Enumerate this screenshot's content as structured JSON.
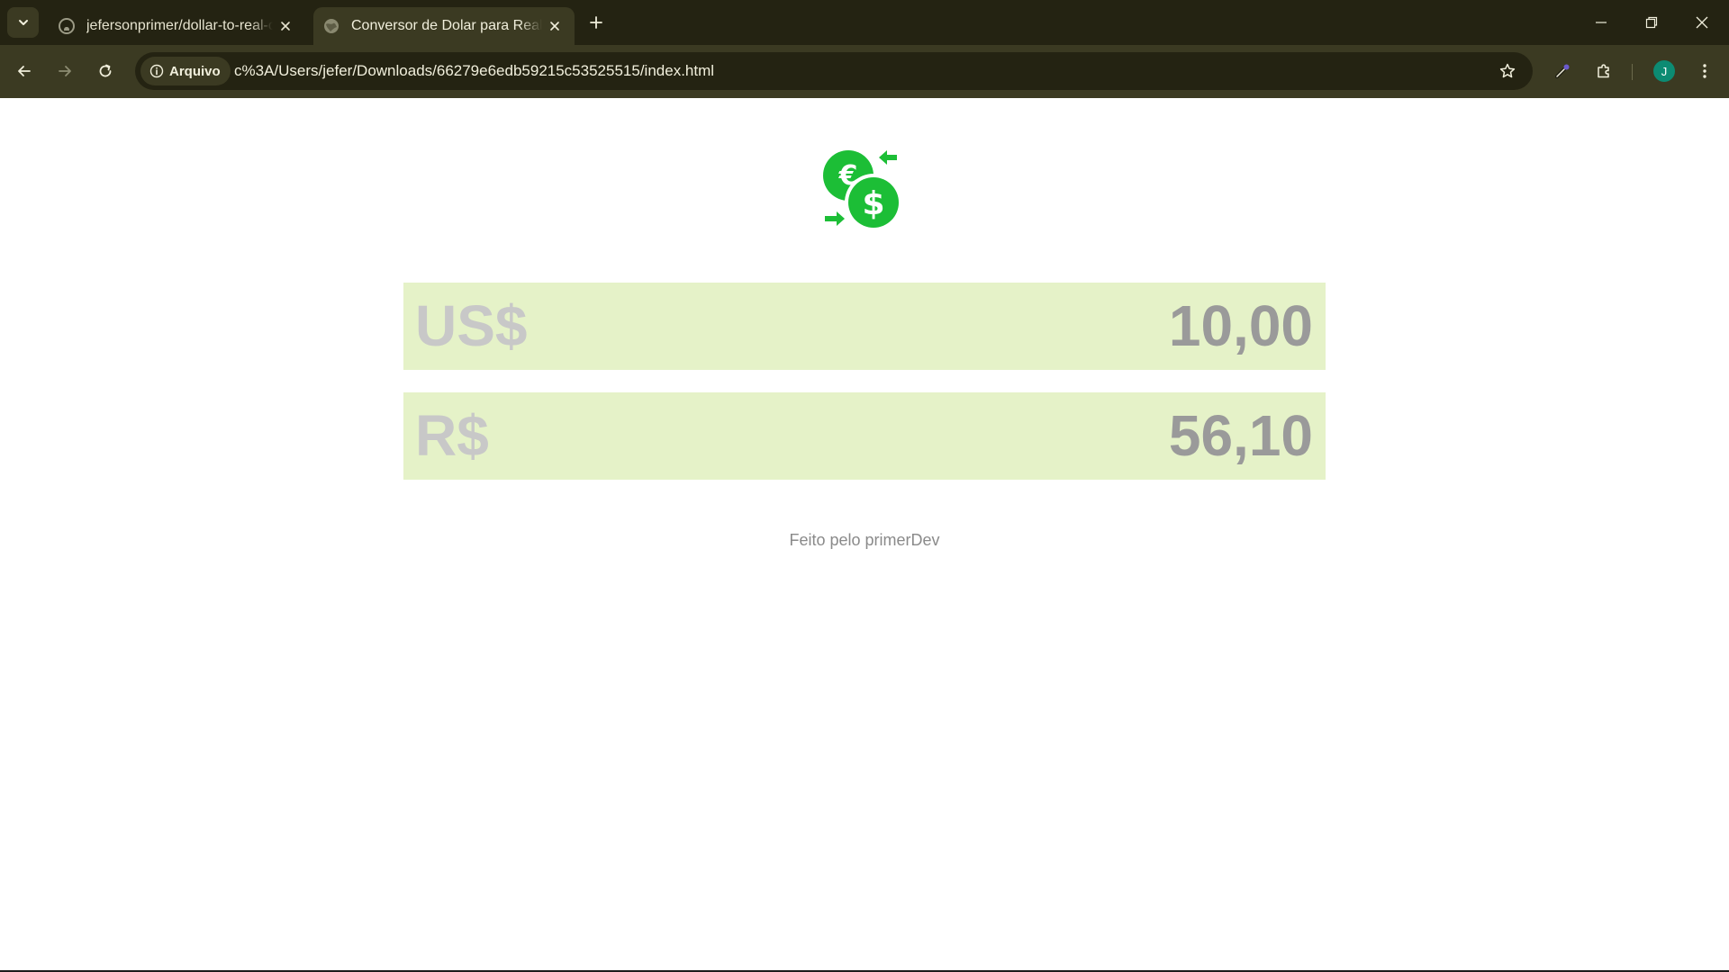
{
  "browser": {
    "tabs": [
      {
        "title": "jefersonprimer/dollar-to-real-co",
        "icon": "github-icon",
        "active": false
      },
      {
        "title": "Conversor de Dolar para Real",
        "icon": "globe-icon",
        "active": true
      }
    ],
    "security_chip_label": "Arquivo",
    "url": "c%3A/Users/jefer/Downloads/66279e6edb59215c53525515/index.html",
    "profile_initial": "J",
    "theme_colors": {
      "frame": "#242312",
      "toolbar": "#3b3a22",
      "text": "#f1efdc"
    }
  },
  "converter": {
    "logo_icon": "currency-exchange-icon",
    "accent_color": "#1cbe36",
    "rows": [
      {
        "currency": "US$",
        "amount": "10,00"
      },
      {
        "currency": "R$",
        "amount": "56,10"
      }
    ],
    "row_background": "#e5f2c8"
  },
  "footer": {
    "text": "Feito pelo primerDev"
  }
}
